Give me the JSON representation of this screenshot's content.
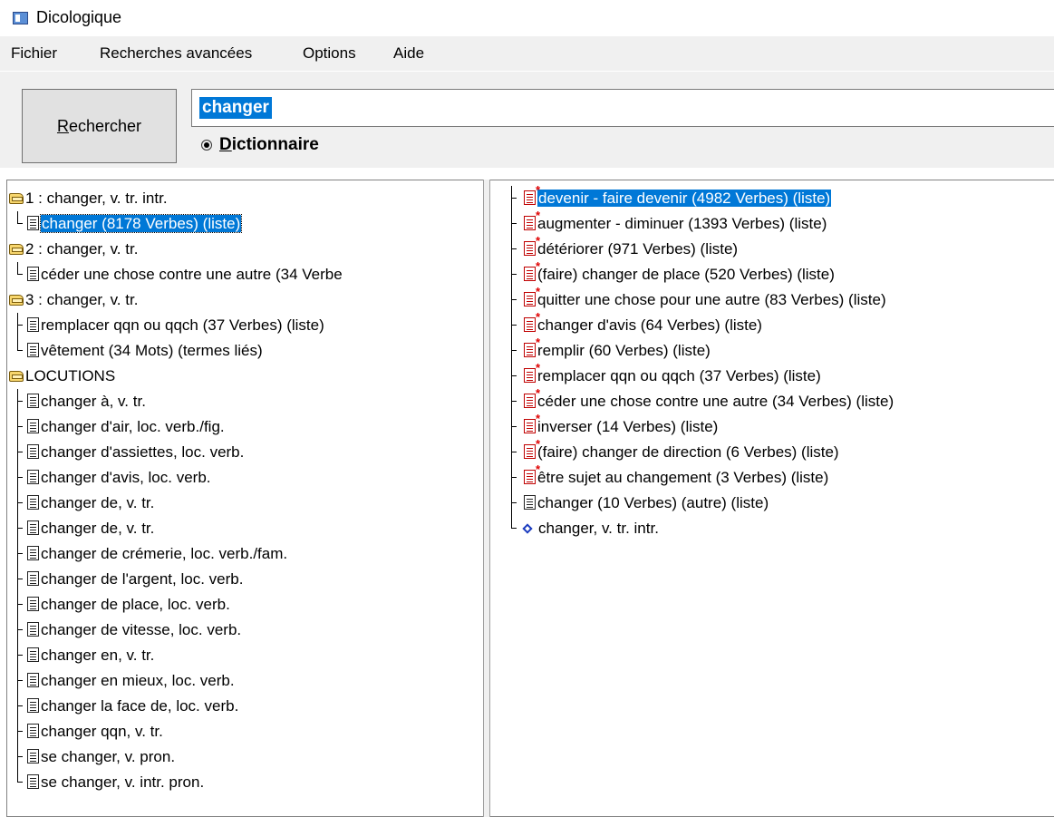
{
  "window": {
    "title": "Dicologique"
  },
  "menu": [
    "Fichier",
    "Recherches avancées",
    "Options",
    "Aide"
  ],
  "toolbar": {
    "search_button_underline": "R",
    "search_button_rest": "echercher",
    "search_value": "changer",
    "radio_underline": "D",
    "radio_rest": "ictionnaire"
  },
  "left_tree": [
    "1 : changer, v. tr. intr.",
    "changer  (8178 Verbes) (liste)",
    "2 : changer, v. tr.",
    "céder une chose contre une autre  (34 Verbe",
    "3 : changer, v. tr.",
    "remplacer qqn ou qqch  (37 Verbes) (liste)",
    "vêtement  (34 Mots) (termes liés)",
    "LOCUTIONS",
    "changer à,  v. tr.",
    "changer d'air,  loc. verb./fig.",
    "changer d'assiettes,  loc. verb.",
    "changer d'avis,  loc. verb.",
    "changer de,  v. tr.",
    "changer de,  v. tr.",
    "changer de crémerie,  loc. verb./fam.",
    "changer de l'argent,  loc. verb.",
    "changer de place,  loc. verb.",
    "changer de vitesse,  loc. verb.",
    "changer en,  v. tr.",
    "changer en mieux,  loc. verb.",
    "changer la face de,  loc. verb.",
    "changer qqn,  v. tr.",
    "se changer,  v. pron.",
    "se changer,  v. intr. pron."
  ],
  "right_list": [
    "devenir - faire devenir  (4982 Verbes) (liste)",
    "augmenter - diminuer  (1393 Verbes) (liste)",
    "détériorer  (971 Verbes) (liste)",
    "(faire) changer de place  (520 Verbes) (liste)",
    "quitter une chose pour une autre  (83 Verbes) (liste)",
    "changer d'avis  (64 Verbes) (liste)",
    "remplir  (60 Verbes) (liste)",
    "remplacer qqn ou qqch  (37 Verbes) (liste)",
    "céder une chose contre une autre  (34 Verbes) (liste)",
    "inverser  (14 Verbes) (liste)",
    "(faire) changer de direction  (6 Verbes) (liste)",
    "être sujet au changement  (3 Verbes) (liste)",
    "changer  (10 Verbes) (autre) (liste)",
    "changer, v. tr. intr."
  ],
  "colors": {
    "selection": "#0078d7",
    "chrome": "#f0f0f0",
    "icon_red": "#c00000",
    "diamond": "#1a3bbf"
  }
}
